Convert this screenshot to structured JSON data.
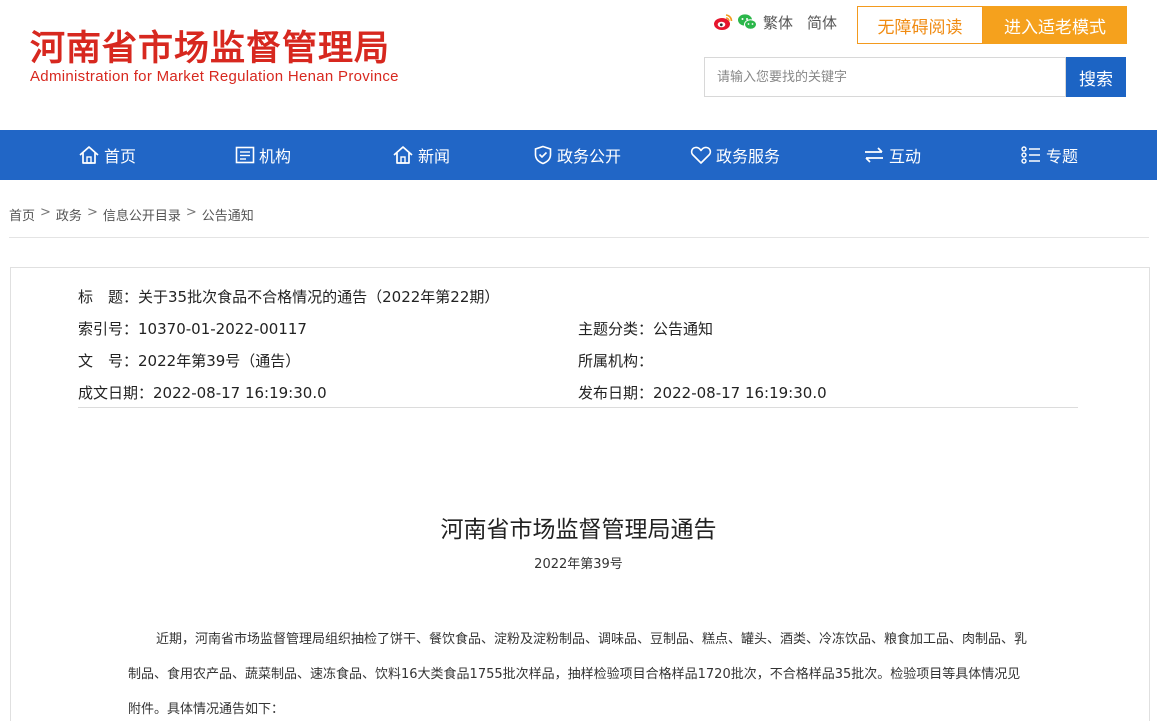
{
  "header": {
    "logo_cn": "河南省市场监督管理局",
    "logo_en": "Administration for Market Regulation Henan Province",
    "lang_traditional": "繁体",
    "lang_simplified": "简体",
    "accessibility_label": "无障碍阅读",
    "elder_mode_label": "进入适老模式",
    "search_placeholder": "请输入您要找的关键字",
    "search_button": "搜索"
  },
  "nav": {
    "items": [
      {
        "label": "首页",
        "icon": "home-icon"
      },
      {
        "label": "机构",
        "icon": "org-icon"
      },
      {
        "label": "新闻",
        "icon": "news-icon"
      },
      {
        "label": "政务公开",
        "icon": "shield-icon"
      },
      {
        "label": "政务服务",
        "icon": "heart-icon"
      },
      {
        "label": "互动",
        "icon": "exchange-icon"
      },
      {
        "label": "专题",
        "icon": "list-icon"
      }
    ]
  },
  "breadcrumb": [
    "首页",
    "政务",
    "信息公开目录",
    "公告通知"
  ],
  "meta": {
    "title_label": "标　题：",
    "title_value": "关于35批次食品不合格情况的通告（2022年第22期）",
    "index_label": "索引号：",
    "index_value": "10370-01-2022-00117",
    "topic_label": "主题分类：",
    "topic_value": "公告通知",
    "docno_label": "文　号：",
    "docno_value": "2022年第39号（通告）",
    "org_label": "所属机构：",
    "org_value": "",
    "created_label": "成文日期：",
    "created_value": "2022-08-17 16:19:30.0",
    "published_label": "发布日期：",
    "published_value": "2022-08-17 16:19:30.0"
  },
  "article": {
    "heading": "河南省市场监督管理局通告",
    "number": "2022年第39号",
    "paragraph": "近期，河南省市场监督管理局组织抽检了饼干、餐饮食品、淀粉及淀粉制品、调味品、豆制品、糕点、罐头、酒类、冷冻饮品、粮食加工品、肉制品、乳制品、食用农产品、蔬菜制品、速冻食品、饮料16大类食品1755批次样品，抽样检验项目合格样品1720批次，不合格样品35批次。检验项目等具体情况见附件。具体情况通告如下："
  },
  "colors": {
    "brand_red": "#d7281f",
    "nav_blue": "#2166c6",
    "search_blue": "#1c64c4",
    "accent_orange": "#f5a11d"
  }
}
